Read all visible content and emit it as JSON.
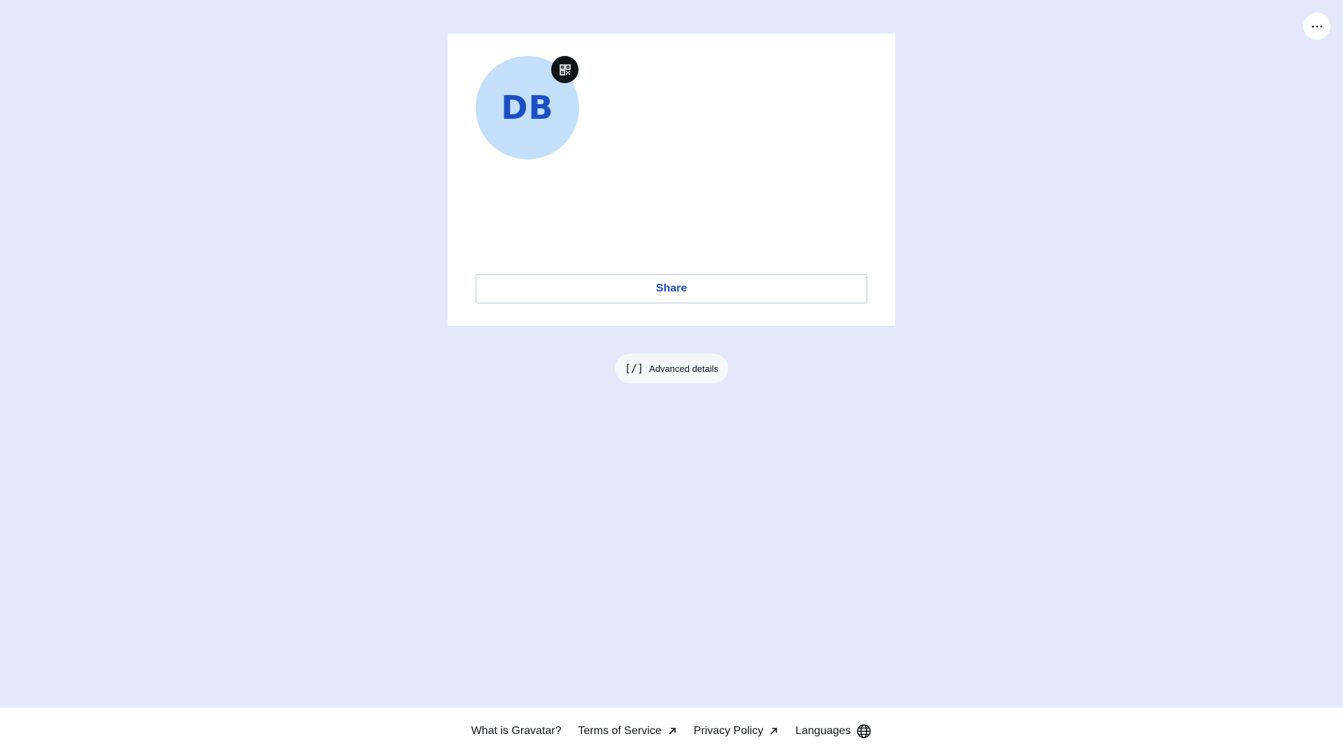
{
  "header": {
    "more_icon": "ellipsis-icon"
  },
  "profile_card": {
    "avatar_initials": "DB",
    "avatar_bg_color": "#c3dffa",
    "avatar_text_color": "#1d4fc4",
    "qr_icon": "qr-code-icon",
    "share_label": "Share"
  },
  "advanced": {
    "icon_glyph": "[/]",
    "label": "Advanced details"
  },
  "footer": {
    "links": [
      {
        "label": "What is Gravatar?",
        "icon": ""
      },
      {
        "label": "Terms of Service",
        "icon": "external-arrow-icon"
      },
      {
        "label": "Privacy Policy",
        "icon": "external-arrow-icon"
      },
      {
        "label": "Languages",
        "icon": "globe-icon"
      }
    ]
  },
  "colors": {
    "page_background": "#e3e9fb",
    "accent": "#1d4fc4"
  }
}
